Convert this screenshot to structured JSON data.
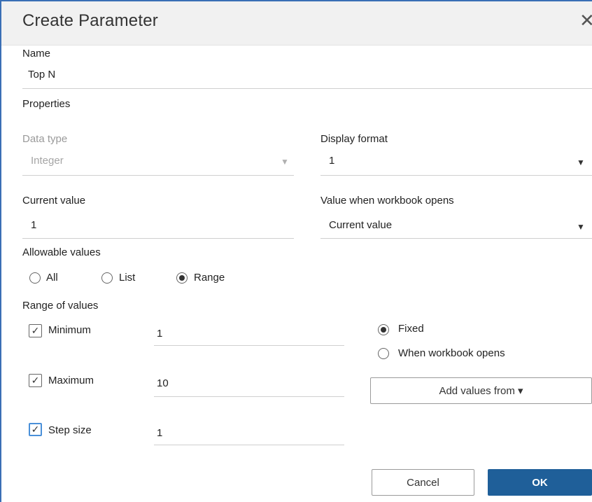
{
  "dialog": {
    "title": "Create Parameter",
    "close_glyph": "✕"
  },
  "name": {
    "label": "Name",
    "value": "Top N"
  },
  "properties": {
    "label": "Properties"
  },
  "data_type": {
    "label": "Data type",
    "value": "Integer"
  },
  "display_format": {
    "label": "Display format",
    "value": "1"
  },
  "current_value": {
    "label": "Current value",
    "value": "1"
  },
  "workbook_opens": {
    "label": "Value when workbook opens",
    "value": "Current value"
  },
  "allowable": {
    "label": "Allowable values",
    "options": [
      "All",
      "List",
      "Range"
    ],
    "selected": "Range"
  },
  "range": {
    "label": "Range of values",
    "minimum": {
      "label": "Minimum",
      "checked": true,
      "value": "1"
    },
    "maximum": {
      "label": "Maximum",
      "checked": true,
      "value": "10"
    },
    "step": {
      "label": "Step size",
      "checked": true,
      "value": "1"
    },
    "fixed_label": "Fixed",
    "when_opens_label": "When workbook opens",
    "fixed_selected": true,
    "add_values_label": "Add values from ▾"
  },
  "buttons": {
    "cancel": "Cancel",
    "ok": "OK"
  },
  "icons": {
    "dropdown": "caret-down-icon",
    "check": "checkmark-icon",
    "close": "close-icon"
  },
  "colors": {
    "primary": "#1f5f99",
    "focus": "#4a90d9",
    "frame": "#3a6fb5"
  }
}
